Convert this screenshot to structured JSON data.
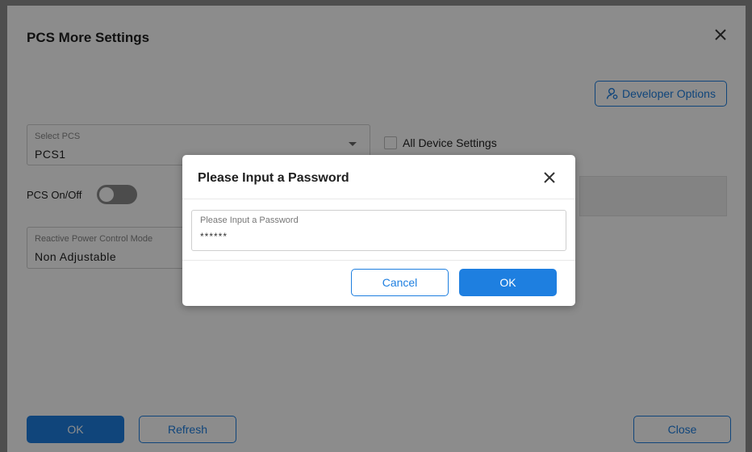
{
  "dialog": {
    "title": "PCS More Settings",
    "close_icon": "close-icon",
    "developer_options": {
      "label": "Developer Options",
      "icon": "user-settings-icon"
    },
    "select_pcs": {
      "label": "Select PCS",
      "value": "PCS1"
    },
    "all_device_settings": {
      "label": "All Device Settings",
      "checked": false
    },
    "pcs_onoff": {
      "label": "PCS On/Off",
      "on": false
    },
    "reactive_power": {
      "label": "Reactive Power Control Mode",
      "value": "Non Adjustable"
    },
    "footer": {
      "ok_label": "OK",
      "refresh_label": "Refresh",
      "close_label": "Close"
    }
  },
  "password_modal": {
    "title": "Please Input a Password",
    "close_icon": "close-icon",
    "field": {
      "label": "Please Input a Password",
      "value": "******"
    },
    "cancel_label": "Cancel",
    "ok_label": "OK"
  },
  "colors": {
    "accent": "#1e7fe0",
    "overlay": "rgba(0,0,0,0.45)"
  }
}
